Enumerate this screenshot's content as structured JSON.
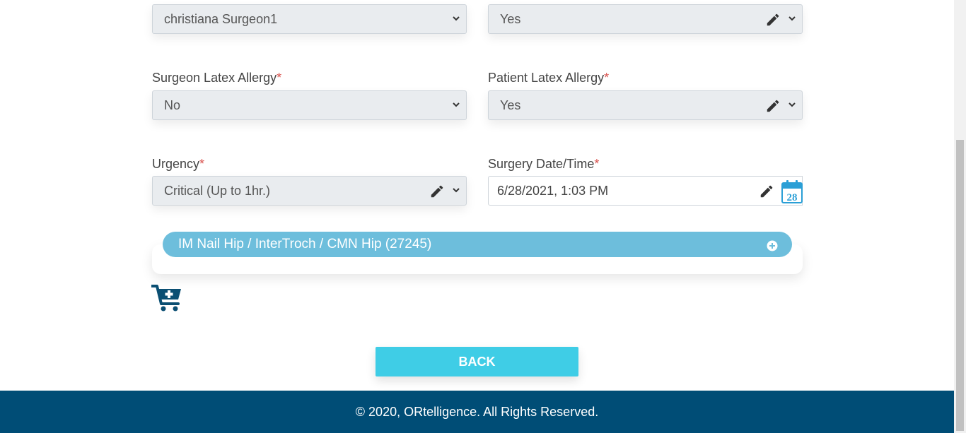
{
  "form": {
    "row0": {
      "left_select_value": "christiana Surgeon1",
      "right_select_value": "Yes"
    },
    "surgeon_latex": {
      "label": "Surgeon Latex Allergy",
      "required_mark": "*",
      "value": "No"
    },
    "patient_latex": {
      "label": "Patient Latex Allergy",
      "required_mark": "*",
      "value": "Yes"
    },
    "urgency": {
      "label": "Urgency",
      "required_mark": "*",
      "value": "Critical (Up to 1hr.)"
    },
    "surgery_datetime": {
      "label": "Surgery Date/Time",
      "required_mark": "*",
      "value": "6/28/2021, 1:03 PM",
      "calendar_day": "28"
    }
  },
  "procedure": {
    "title": "IM Nail Hip / InterTroch / CMN Hip (27245)"
  },
  "actions": {
    "back_label": "BACK"
  },
  "footer": {
    "text": "© 2020, ORtelligence. All Rights Reserved."
  },
  "colors": {
    "accent": "#3fcde6",
    "procedure_bar": "#6dbedc",
    "footer_bg": "#004d76",
    "cart_icon": "#0b4f73",
    "required": "#d9534f"
  }
}
